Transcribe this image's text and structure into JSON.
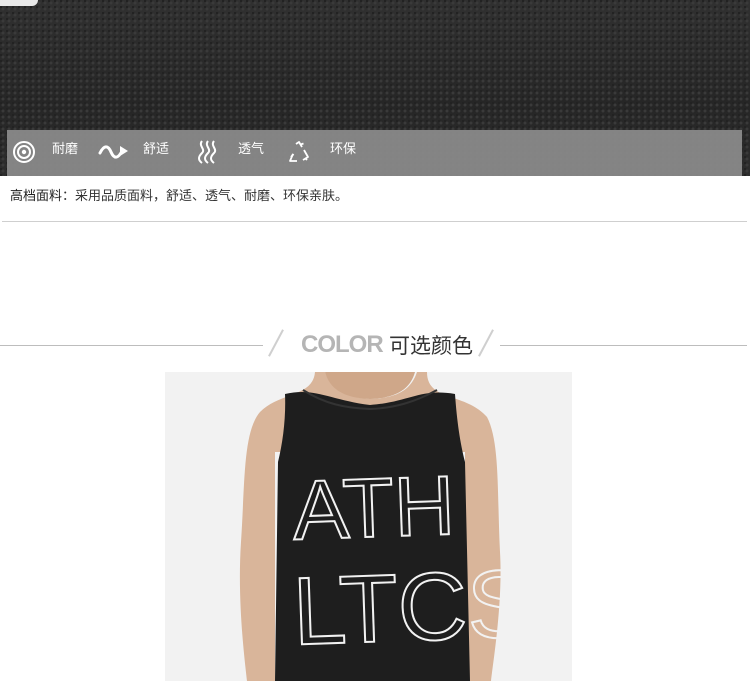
{
  "features": [
    {
      "icon": "target-rings-icon",
      "label": "耐磨"
    },
    {
      "icon": "wave-arrow-icon",
      "label": "舒适"
    },
    {
      "icon": "airflow-waves-icon",
      "label": "透气"
    },
    {
      "icon": "recycle-icon",
      "label": "环保"
    }
  ],
  "description": {
    "heading": "高档面料",
    "separator": "：",
    "text": "采用品质面料，舒适、透气、耐磨、环保亲肤。"
  },
  "color_section": {
    "title_en": "COLOR",
    "title_cn": "可选颜色"
  },
  "product_photo": {
    "shirt_print": [
      "ATH",
      "LTCS"
    ],
    "shirt_color": "#1e1e1e",
    "background_color": "#f2f2f2"
  }
}
